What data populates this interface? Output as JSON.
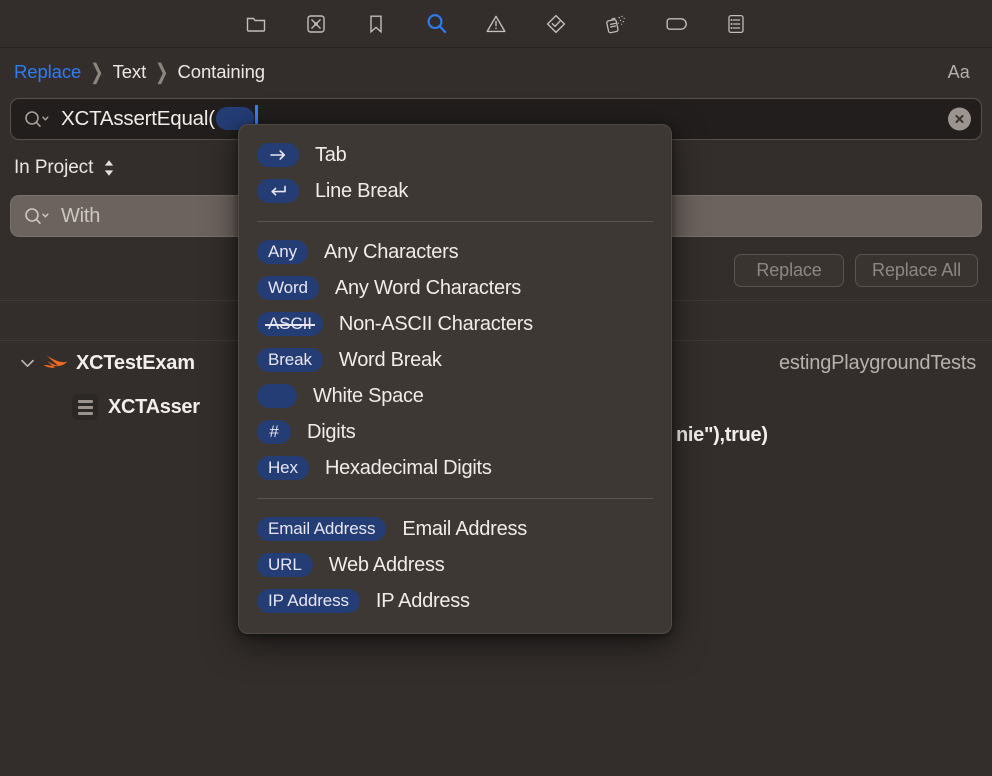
{
  "window": {
    "background_color": "#332e2c",
    "panel_color": "#3e3835",
    "accent_color": "#2f7cf6",
    "pill_color": "#243d75"
  },
  "navigator_toolbar": {
    "items": [
      {
        "name": "project-navigator-icon",
        "label": "Project",
        "active": false
      },
      {
        "name": "test-navigator-icon",
        "label": "Tests",
        "active": false
      },
      {
        "name": "bookmark-navigator-icon",
        "label": "Bookmarks",
        "active": false
      },
      {
        "name": "find-navigator-icon",
        "label": "Find",
        "active": true
      },
      {
        "name": "issue-navigator-icon",
        "label": "Issues",
        "active": false
      },
      {
        "name": "checkmark-diamond-icon",
        "label": "Tests Passed",
        "active": false
      },
      {
        "name": "spray-can-debug-icon",
        "label": "Debug",
        "active": false
      },
      {
        "name": "tag-label-icon",
        "label": "Labels",
        "active": false
      },
      {
        "name": "report-navigator-icon",
        "label": "Reports",
        "active": false
      }
    ]
  },
  "scope_bar": {
    "crumbs": [
      {
        "label": "Replace",
        "is_link": true
      },
      {
        "label": "Text",
        "is_link": false
      },
      {
        "label": "Containing",
        "is_link": false
      }
    ],
    "separator": "❯",
    "case_sensitivity_label": "Aa"
  },
  "find_field": {
    "icon": "magnifying-glass-with-chevron-icon",
    "value": "XCTAssertEqual(",
    "has_token_pill": true,
    "has_caret": true,
    "clear_button_label": "×"
  },
  "scope_selector": {
    "label": "In Project",
    "stepper_icon": "up-down-chevron-icon"
  },
  "replace_field": {
    "icon": "magnifying-glass-with-chevron-icon",
    "placeholder": "With",
    "value": ""
  },
  "action_buttons": [
    {
      "name": "replace-button",
      "label": "Replace",
      "enabled": false
    },
    {
      "name": "replace-all-button",
      "label": "Replace All",
      "enabled": false
    }
  ],
  "results": {
    "file_row": {
      "disclosure_state": "expanded",
      "file_icon": "swift-file-icon",
      "file_name": "XCTestExam",
      "target_name": "estingPlaygroundTests"
    },
    "match_row": {
      "icon": "text-match-icon",
      "snippet_bold": "XCTAsser",
      "snippet_bold_tail": "nie\"),",
      "snippet_plain": " true)"
    }
  },
  "popup_menu": {
    "groups": [
      {
        "items": [
          {
            "pill_type": "icon-arrow-right",
            "pill_text": "",
            "label": "Tab"
          },
          {
            "pill_type": "icon-return",
            "pill_text": "",
            "label": "Line Break"
          }
        ]
      },
      {
        "items": [
          {
            "pill_type": "text",
            "pill_text": "Any",
            "label": "Any Characters"
          },
          {
            "pill_type": "text",
            "pill_text": "Word",
            "label": "Any Word Characters"
          },
          {
            "pill_type": "text-strikethrough",
            "pill_text": "ASCII",
            "label": "Non-ASCII Characters"
          },
          {
            "pill_type": "text",
            "pill_text": "Break",
            "label": "Word Break"
          },
          {
            "pill_type": "blank",
            "pill_text": "",
            "label": "White Space"
          },
          {
            "pill_type": "text",
            "pill_text": "#",
            "label": "Digits"
          },
          {
            "pill_type": "text",
            "pill_text": "Hex",
            "label": "Hexadecimal Digits"
          }
        ]
      },
      {
        "items": [
          {
            "pill_type": "text",
            "pill_text": "Email Address",
            "label": "Email Address"
          },
          {
            "pill_type": "text",
            "pill_text": "URL",
            "label": "Web Address"
          },
          {
            "pill_type": "text",
            "pill_text": "IP Address",
            "label": "IP Address"
          }
        ]
      }
    ]
  }
}
